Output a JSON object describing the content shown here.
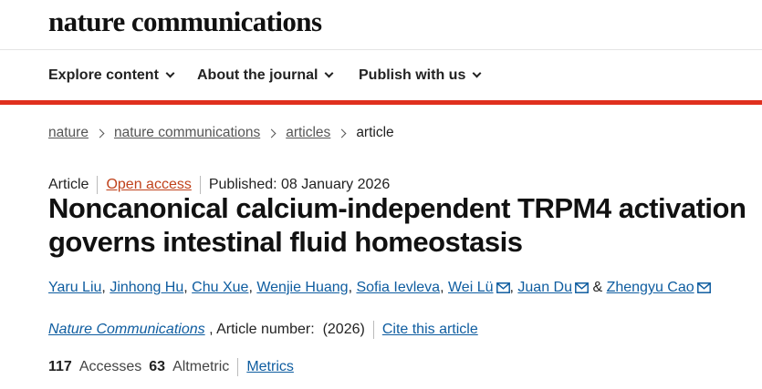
{
  "brand": {
    "logo_text": "nature communications"
  },
  "nav": {
    "items": [
      {
        "label": "Explore content"
      },
      {
        "label": "About the journal"
      },
      {
        "label": "Publish with us"
      }
    ]
  },
  "colors": {
    "accent_rule": "#e0301e",
    "link": "#0f5da0",
    "open_access": "#c0421b"
  },
  "breadcrumb": {
    "items": [
      "nature",
      "nature communications",
      "articles"
    ],
    "current": "article"
  },
  "article": {
    "type": "Article",
    "access": "Open access",
    "published": "Published: 08 January 2026",
    "title": "Noncanonical calcium-independent TRPM4 activation governs intestinal fluid homeostasis",
    "authors": [
      {
        "name": "Yaru Liu",
        "corresponding": false
      },
      {
        "name": "Jinhong Hu",
        "corresponding": false
      },
      {
        "name": "Chu Xue",
        "corresponding": false
      },
      {
        "name": "Wenjie Huang",
        "corresponding": false
      },
      {
        "name": "Sofia Ievleva",
        "corresponding": false
      },
      {
        "name": "Wei Lü",
        "corresponding": true
      },
      {
        "name": "Juan Du",
        "corresponding": true
      },
      {
        "name": "Zhengyu Cao",
        "corresponding": true
      }
    ],
    "author_separator": ",",
    "author_last_joiner": "&",
    "journal": "Nature Communications",
    "article_number_label": ", Article number:",
    "year": "(2026)",
    "cite_label": "Cite this article"
  },
  "metrics": {
    "accesses_count": "117",
    "accesses_label": "Accesses",
    "altmetric_count": "63",
    "altmetric_label": "Altmetric",
    "metrics_link": "Metrics"
  },
  "icons": {
    "nav_dropdown": "chevron-down-icon",
    "breadcrumb_separator": "chevron-right-icon",
    "author_email": "mail-icon"
  }
}
